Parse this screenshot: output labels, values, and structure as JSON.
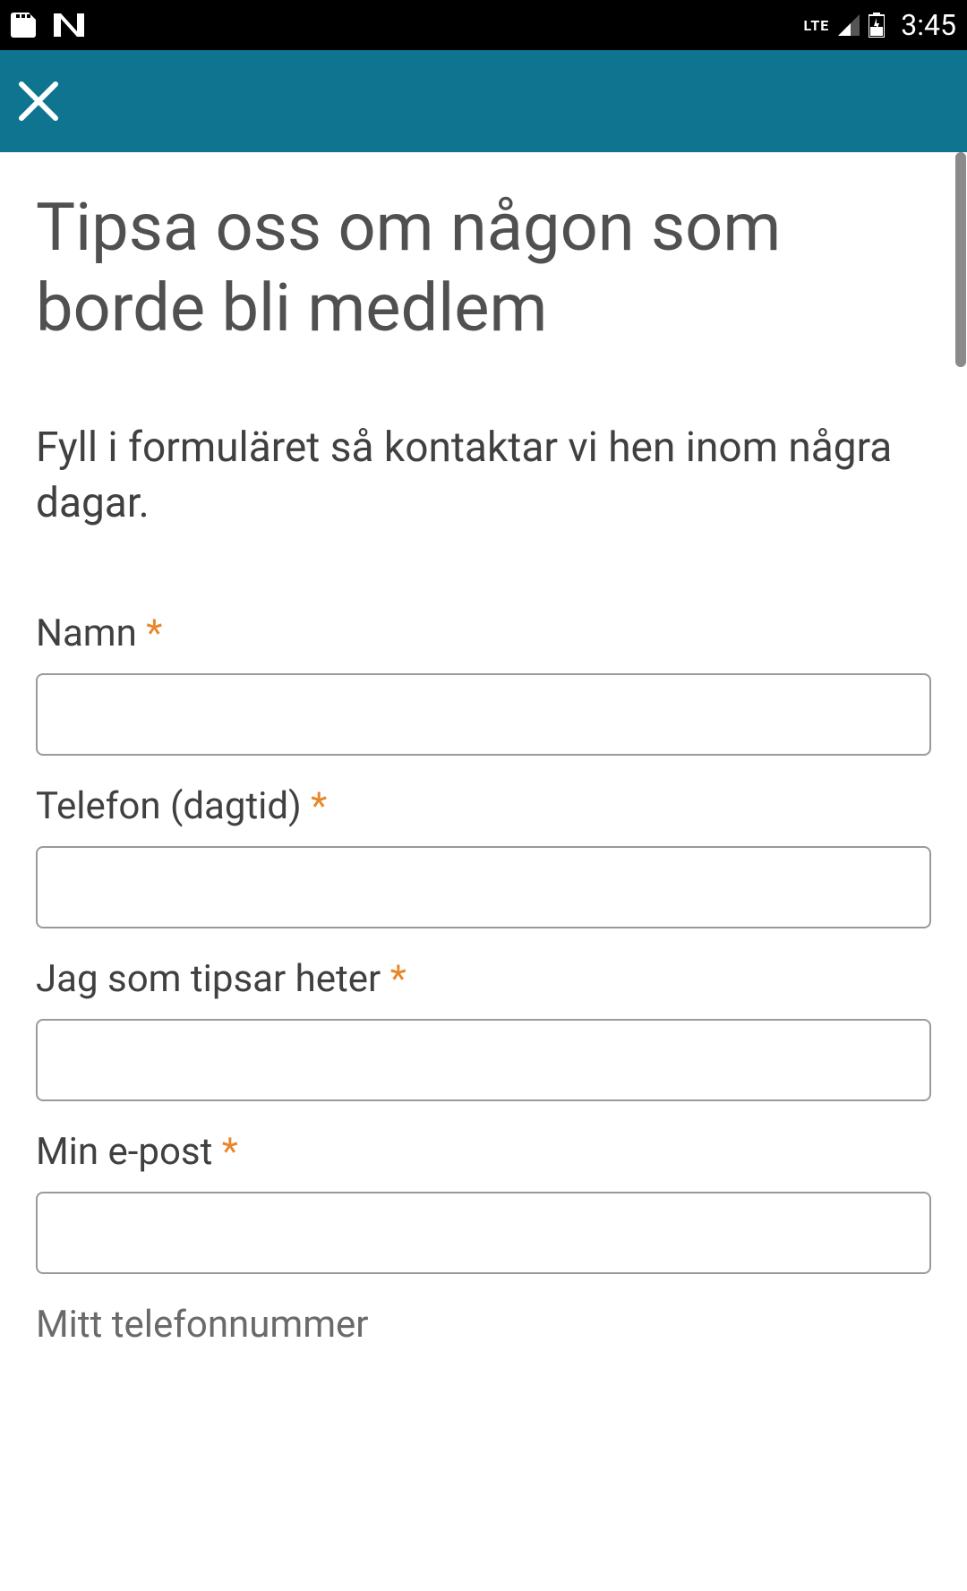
{
  "status_bar": {
    "lte_label": "LTE",
    "time": "3:45"
  },
  "page": {
    "title": "Tipsa oss om någon som borde bli medlem",
    "subtitle": "Fyll i formuläret så kontaktar vi hen inom några dagar."
  },
  "form": {
    "required_mark": "*",
    "fields": [
      {
        "label": "Namn",
        "value": "",
        "required": true
      },
      {
        "label": "Telefon (dagtid)",
        "value": "",
        "required": true
      },
      {
        "label": "Jag som tipsar heter",
        "value": "",
        "required": true
      },
      {
        "label": "Min e-post",
        "value": "",
        "required": true
      },
      {
        "label": "Mitt telefonnummer",
        "value": "",
        "required": false
      }
    ]
  }
}
